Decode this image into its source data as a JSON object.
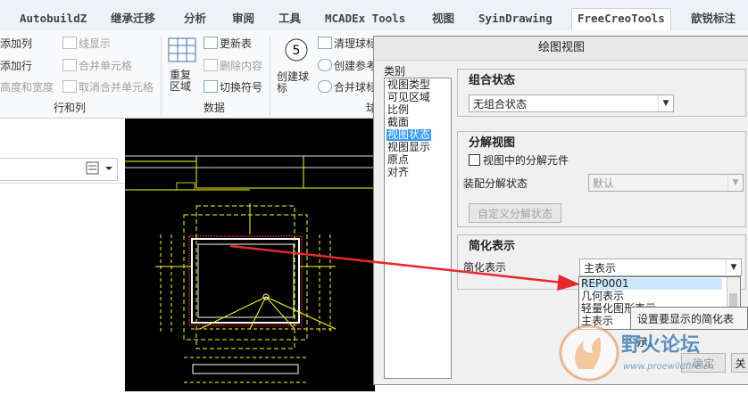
{
  "tabs": [
    "AutobuildZ",
    "继承迁移",
    "分析",
    "审阅",
    "工具",
    "MCADEx Tools",
    "视图",
    "SyinDrawing",
    "FreeCreoTools",
    "歆锐标注"
  ],
  "ribbon": {
    "rows_cols": {
      "add_col": "添加列",
      "add_row": "添加行",
      "height_width": "高度和宽度",
      "line_display": "线显示",
      "merge_cells": "合并单元格",
      "unmerge_cells": "取消合并单元格",
      "group_label": "行和列"
    },
    "data": {
      "repeat_region": "重复\n区域",
      "update_table": "更新表",
      "delete_content": "删除内容",
      "switch_symbol": "切换符号",
      "group_label": "数据"
    },
    "balloons": {
      "create_balloon": "创建球\n标",
      "clean_balloon": "清理球标",
      "create_ref": "创建参考",
      "merge_balloon": "合并球标",
      "group_label_partial": "球"
    }
  },
  "dialog": {
    "title": "绘图视图",
    "category_label": "类别",
    "categories": [
      "视图类型",
      "可见区域",
      "比例",
      "截面",
      "视图状态",
      "视图显示",
      "原点",
      "对齐"
    ],
    "selected_category": "视图状态",
    "combined_state": {
      "title": "组合状态",
      "value": "无组合状态"
    },
    "exploded": {
      "title": "分解视图",
      "checkbox_label": "视图中的分解元件",
      "assembly_label": "装配分解状态",
      "assembly_value": "默认",
      "custom_button": "自定义分解状态"
    },
    "simplified": {
      "title": "简化表示",
      "label": "简化表示",
      "value": "主表示",
      "options": [
        "REP0001",
        "几何表示",
        "轻量化图形表示",
        "主表示"
      ],
      "highlighted": "REP0001"
    },
    "ok_button": "确定",
    "close_button": "关"
  },
  "tooltip": "设置要显示的简化表示。",
  "watermark": {
    "name": "野火论坛",
    "url": "www.proewildfire.cn"
  },
  "colors": {
    "arrow": "#e8282d",
    "selection": "#3399ff",
    "drawing_yellow": "#ffff00",
    "canvas": "#000000"
  }
}
